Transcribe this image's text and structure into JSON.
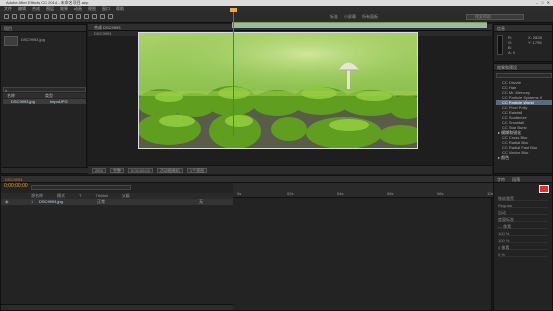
{
  "window": {
    "title": "Adobe After Effects CC 2014 - 未命名项目.aep",
    "controls": [
      "–",
      "□",
      "✕"
    ]
  },
  "menu": [
    "文件",
    "编辑",
    "合成",
    "图层",
    "效果",
    "动画",
    "视图",
    "窗口",
    "帮助"
  ],
  "toolbar": {
    "workspaces": [
      "标准",
      "小屏幕",
      "所有面板"
    ],
    "search_placeholder": "搜索帮助"
  },
  "project": {
    "tab": "项目",
    "search_placeholder": "",
    "columns": [
      "名称",
      "类型"
    ],
    "items": [
      {
        "name": "DSC9993.jpg",
        "type": "ImpotJPG"
      }
    ],
    "thumb_name": "DSC9993.jpg"
  },
  "comp": {
    "tab": "合成 DSC9993",
    "sub": "DSC9993",
    "zoom": "25%",
    "res": "完整",
    "time": "0;00;00;00",
    "view": "活动摄像机",
    "views": "1个视图"
  },
  "info": {
    "tab": "信息",
    "lines": [
      "R:",
      "G:",
      "B:",
      "A: 0"
    ],
    "coords": [
      "X: 2828",
      "Y: 1795"
    ]
  },
  "effects": {
    "tab": "效果和预设",
    "items": [
      {
        "label": "CC Drizzle",
        "cat": false
      },
      {
        "label": "CC Hair",
        "cat": false
      },
      {
        "label": "CC Mr. Mercury",
        "cat": false
      },
      {
        "label": "CC Particle Systems II",
        "cat": false
      },
      {
        "label": "CC Particle World",
        "cat": false,
        "selected": true
      },
      {
        "label": "CC Pixel Polly",
        "cat": false
      },
      {
        "label": "CC Rainfall",
        "cat": false
      },
      {
        "label": "CC Scatterize",
        "cat": false
      },
      {
        "label": "CC Snowfall",
        "cat": false
      },
      {
        "label": "CC Star Burst",
        "cat": false
      },
      {
        "label": "▸ 模糊和锐化",
        "cat": true
      },
      {
        "label": "CC Cross Blur",
        "cat": false
      },
      {
        "label": "CC Radial Blur",
        "cat": false
      },
      {
        "label": "CC Radial Fast Blur",
        "cat": false
      },
      {
        "label": "CC Vector Blur",
        "cat": false
      },
      {
        "label": "▸ 颜色",
        "cat": true
      }
    ]
  },
  "timeline": {
    "tab": "DSC9993",
    "time": "0;00;00;00",
    "columns": [
      "源名称",
      "模式",
      "T",
      "TrkMat",
      "父级"
    ],
    "layers": [
      {
        "num": "1",
        "name": "DSC9993.jpg",
        "mode": "正常",
        "parent": "无"
      }
    ],
    "ruler": [
      "0s",
      "02s",
      "04s",
      "06s",
      "08s",
      "10s"
    ]
  },
  "paragraph": {
    "tabs": [
      "字符",
      "段落"
    ],
    "rows": [
      "微软雅黑",
      "Regular",
      "自动",
      "度量标准",
      "— 像素",
      "100 %",
      "100 %",
      "0 像素",
      "0 %"
    ],
    "swatch_color": "#e83020"
  },
  "colors": {
    "accent": "#e8b030",
    "playhead": "#d84040",
    "layer_bar": "#9ab7b0"
  }
}
